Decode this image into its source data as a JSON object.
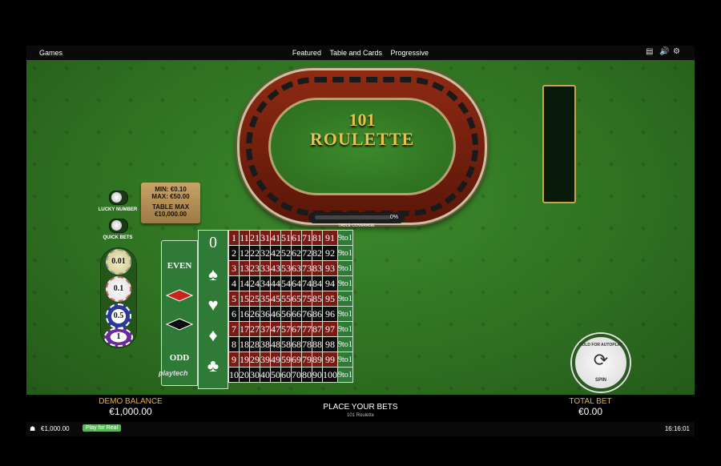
{
  "topbar": {
    "games": "Games",
    "nav": [
      "Featured",
      "Table and Cards",
      "Progressive"
    ]
  },
  "wheel": {
    "title_line1": "101",
    "title_line2": "ROULETTE"
  },
  "coverage": {
    "label": "TABLE COVERAGE",
    "percent": "0%"
  },
  "limits": {
    "min": "MIN: €0.10",
    "max": "MAX: €50.00",
    "table_max_label": "TABLE MAX",
    "table_max_value": "€10,000.00"
  },
  "toggles": {
    "lucky": "LUCKY NUMBER",
    "quick": "QUICK BETS"
  },
  "chips": [
    "0.01",
    "0.1",
    "0.5",
    "1"
  ],
  "board": {
    "zero": "0",
    "outside": [
      "EVEN",
      "ODD"
    ],
    "suits": [
      "♠",
      "♥",
      "♦",
      "♣"
    ],
    "rows": [
      [
        "1",
        "11",
        "21",
        "31",
        "41",
        "51",
        "61",
        "71",
        "81",
        "91"
      ],
      [
        "2",
        "12",
        "22",
        "32",
        "42",
        "52",
        "62",
        "72",
        "82",
        "92"
      ],
      [
        "3",
        "13",
        "23",
        "33",
        "43",
        "53",
        "63",
        "73",
        "83",
        "93"
      ],
      [
        "4",
        "14",
        "24",
        "34",
        "44",
        "54",
        "64",
        "74",
        "84",
        "94"
      ],
      [
        "5",
        "15",
        "25",
        "35",
        "45",
        "55",
        "65",
        "75",
        "85",
        "95"
      ],
      [
        "6",
        "16",
        "26",
        "36",
        "46",
        "56",
        "66",
        "76",
        "86",
        "96"
      ],
      [
        "7",
        "17",
        "27",
        "37",
        "47",
        "57",
        "67",
        "77",
        "87",
        "97"
      ],
      [
        "8",
        "18",
        "28",
        "38",
        "48",
        "58",
        "68",
        "78",
        "88",
        "98"
      ],
      [
        "9",
        "19",
        "29",
        "39",
        "49",
        "59",
        "69",
        "79",
        "89",
        "99"
      ],
      [
        "10",
        "20",
        "30",
        "40",
        "50",
        "60",
        "70",
        "80",
        "90",
        "100"
      ]
    ],
    "row_colors": [
      "r",
      "b",
      "r",
      "b",
      "r",
      "b",
      "r",
      "b",
      "r",
      "b"
    ],
    "payout": "9to1"
  },
  "brand": "playtech",
  "spin": {
    "top": "HOLD FOR AUTOPLAY",
    "bottom": "SPIN"
  },
  "bottom": {
    "demo_label": "DEMO BALANCE",
    "demo_value": "€1,000.00",
    "place": "PLACE YOUR BETS",
    "game": "101 Roulette",
    "total_label": "TOTAL BET",
    "total_value": "€0.00"
  },
  "status": {
    "balance": "€1,000.00",
    "play_real": "Play for Real",
    "time": "16:16:01"
  }
}
